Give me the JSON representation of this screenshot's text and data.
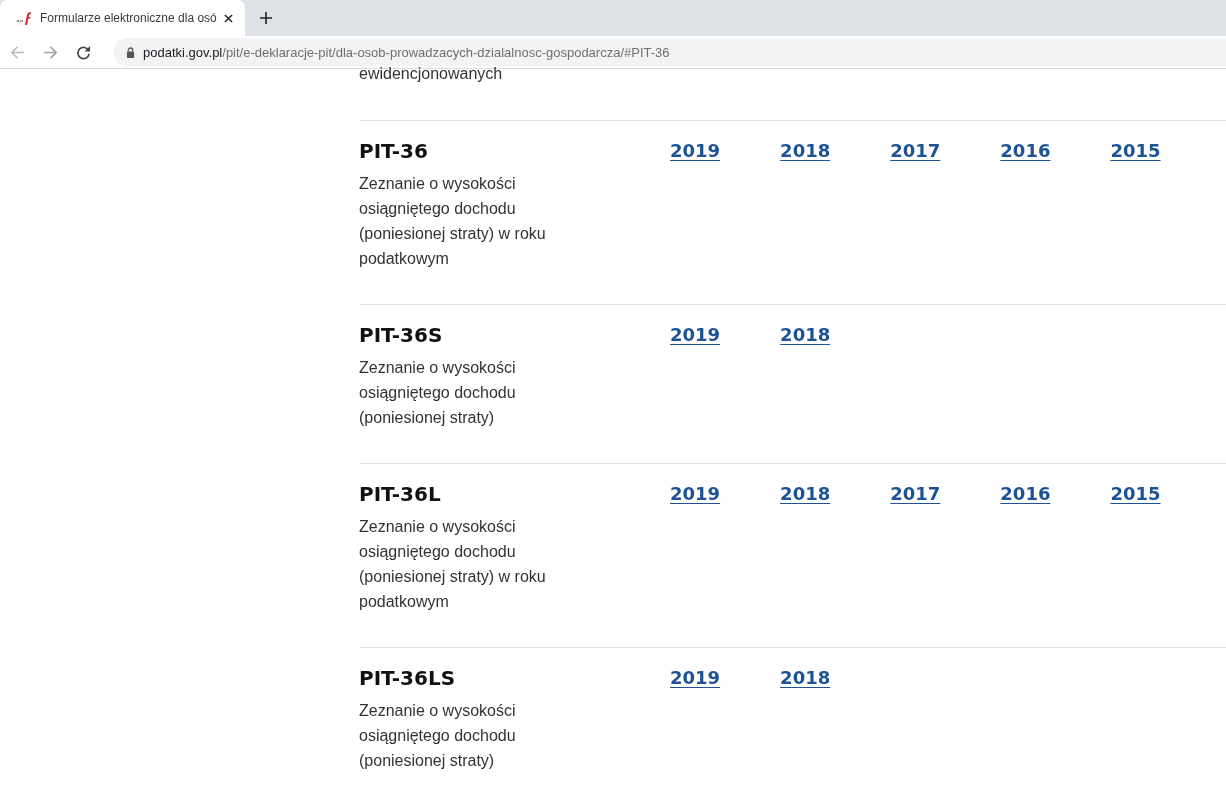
{
  "browser": {
    "tabs": [
      {
        "title": "Formularze elektroniczne dla osó",
        "selected": true
      }
    ],
    "address_bar": {
      "host": "podatki.gov.pl",
      "path": "/pit/e-deklaracje-pit/dla-osob-prowadzacych-dzialalnosc-gospodarcza/#PIT-36"
    }
  },
  "page": {
    "previous_text_tail": "ewidencjonowanych",
    "forms": [
      {
        "name": "PIT-36",
        "description": "Zeznanie o wysokości osiągniętego dochodu (poniesionej straty) w roku podatkowym",
        "years": [
          "2019",
          "2018",
          "2017",
          "2016",
          "2015"
        ]
      },
      {
        "name": "PIT-36S",
        "description": "Zeznanie o wysokości osiągniętego dochodu (poniesionej straty)",
        "years": [
          "2019",
          "2018"
        ]
      },
      {
        "name": "PIT-36L",
        "description": "Zeznanie o wysokości osiągniętego dochodu (poniesionej straty) w roku podatkowym",
        "years": [
          "2019",
          "2018",
          "2017",
          "2016",
          "2015"
        ]
      },
      {
        "name": "PIT-36LS",
        "description": "Zeznanie o wysokości osiągniętego dochodu (poniesionej straty)",
        "years": [
          "2019",
          "2018"
        ]
      }
    ]
  }
}
